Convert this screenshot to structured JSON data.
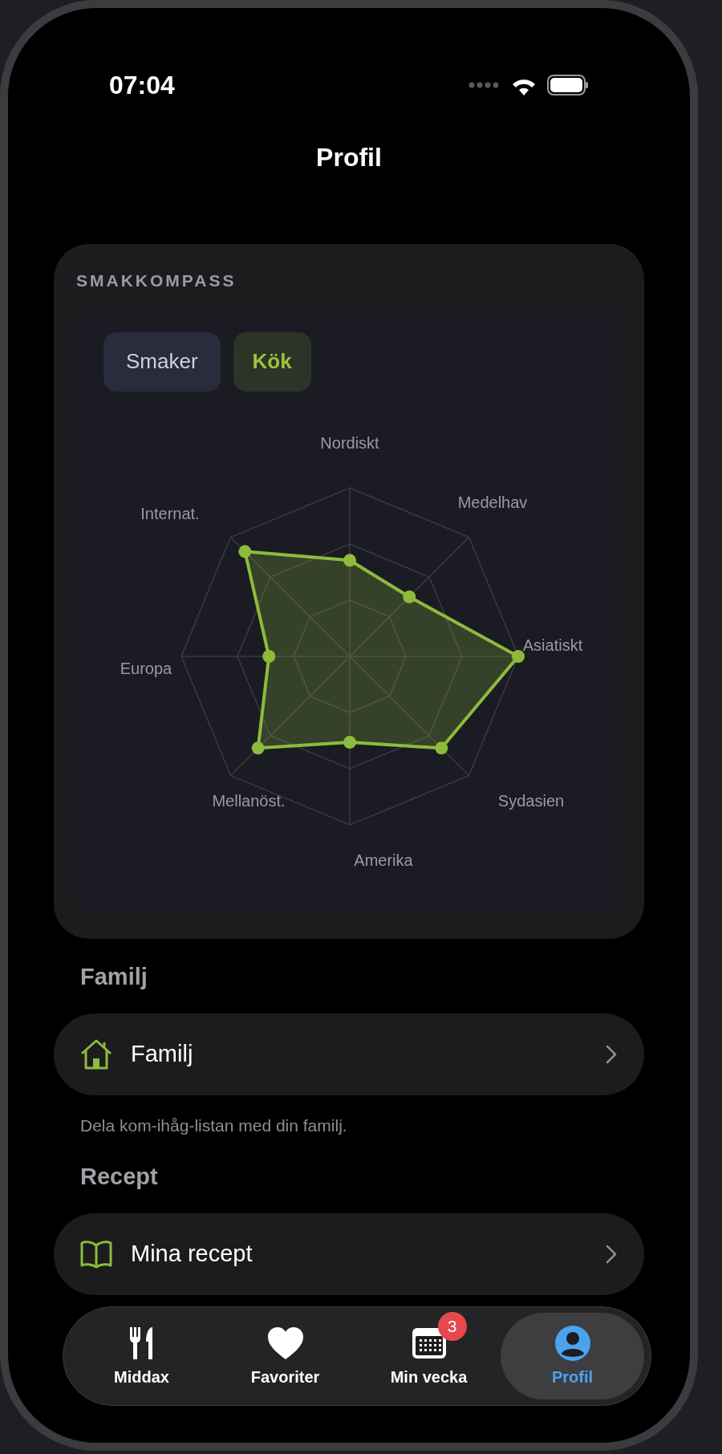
{
  "status_bar": {
    "time": "07:04"
  },
  "nav": {
    "title": "Profil"
  },
  "taste_compass": {
    "title": "SMAKKOMPASS",
    "toggles": [
      {
        "label": "Smaker",
        "selected": false
      },
      {
        "label": "Kök",
        "selected": true
      }
    ],
    "axes": [
      {
        "label": "Nordiskt"
      },
      {
        "label": "Medelhav"
      },
      {
        "label": "Asiatiskt"
      },
      {
        "label": "Sydasien"
      },
      {
        "label": "Amerika"
      },
      {
        "label": "Mellanöst."
      },
      {
        "label": "Europa"
      },
      {
        "label": "Internat."
      }
    ]
  },
  "sections": [
    {
      "heading": "Familj",
      "rows": [
        {
          "kind": "house",
          "label": "Familj"
        }
      ],
      "note": "Dela kom-ihåg-listan med din familj."
    },
    {
      "heading": "Recept",
      "rows": [
        {
          "kind": "book",
          "label": "Mina recept"
        }
      ]
    }
  ],
  "tab_bar": [
    {
      "kind": "cutlery",
      "label": "Middax",
      "selected": false
    },
    {
      "kind": "heart",
      "label": "Favoriter",
      "selected": false
    },
    {
      "kind": "calendar",
      "label": "Min vecka",
      "badge": "3",
      "selected": false
    },
    {
      "kind": "person",
      "label": "Profil",
      "selected": true
    }
  ]
}
